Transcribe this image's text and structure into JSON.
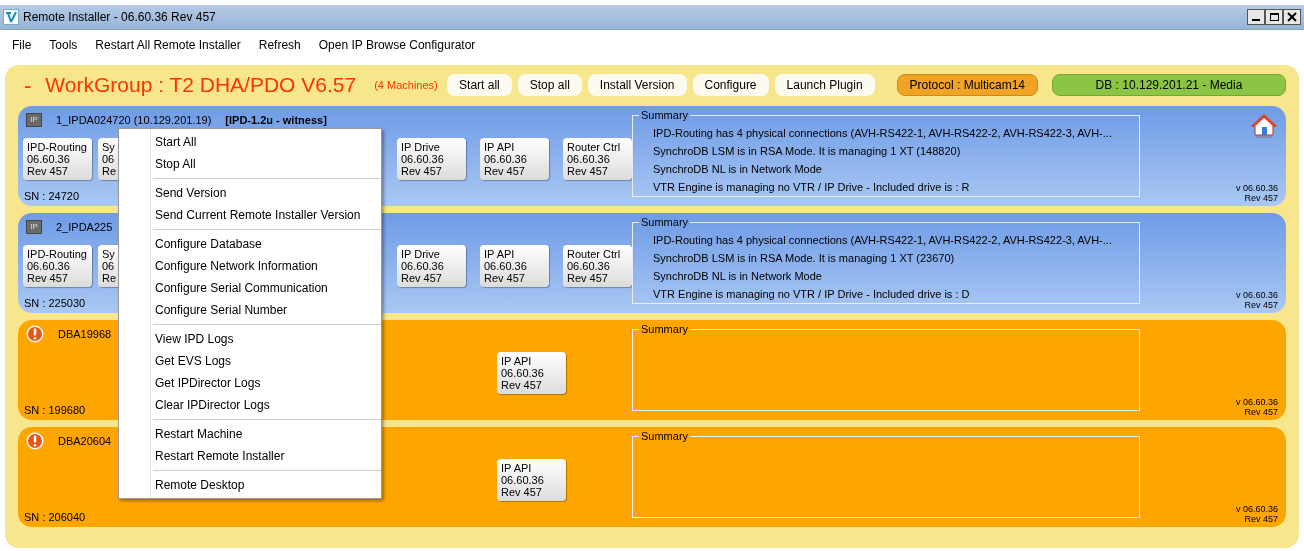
{
  "window": {
    "title": "Remote Installer - 06.60.36 Rev 457"
  },
  "menu_bar": [
    "File",
    "Tools",
    "Restart All Remote Installer",
    "Refresh",
    "Open IP Browse Configurator"
  ],
  "workgroup": {
    "collapse_sign": "-",
    "title": "WorkGroup : T2 DHA/PDO V6.57",
    "count": "(4 Machines)",
    "buttons": [
      {
        "label": "Start all",
        "kind": "plain"
      },
      {
        "label": "Stop all",
        "kind": "plain"
      },
      {
        "label": "Install Version",
        "kind": "plain"
      },
      {
        "label": "Configure",
        "kind": "plain"
      },
      {
        "label": "Launch Plugin",
        "kind": "plain"
      },
      {
        "label": "Protocol : Multicam14",
        "kind": "protocol"
      },
      {
        "label": "DB : 10.129.201.21 - Media",
        "kind": "db"
      }
    ]
  },
  "machines": [
    {
      "kind": "ok",
      "badge": "IP",
      "name": "1_IPDA024720 (10.129.201.19)",
      "tag": "[IPD-1.2u - witness]",
      "home": true,
      "modules_left": [
        {
          "name": "IPD-Routing",
          "version": "06.60.36",
          "rev": "Rev 457"
        },
        {
          "name": "Sy",
          "version": "06",
          "rev": "Re"
        }
      ],
      "modules_right": [
        {
          "name": "IP Drive",
          "version": "06.60.36",
          "rev": "Rev 457"
        },
        {
          "name": "IP API",
          "version": "06.60.36",
          "rev": "Rev 457"
        },
        {
          "name": "Router Ctrl",
          "version": "06.60.36",
          "rev": "Rev 457"
        }
      ],
      "sn": "SN : 24720",
      "summary_title": "Summary",
      "summary": [
        "IPD-Routing has 4 physical connections (AVH-RS422-1, AVH-RS422-2, AVH-RS422-3, AVH-...",
        "SynchroDB LSM is in RSA Mode. It is managing 1 XT (148820)",
        "SynchroDB NL is in Network Mode",
        "VTR Engine is managing no VTR / IP Drive - Included drive is : R"
      ],
      "version": "v 06.60.36",
      "rev": "Rev 457"
    },
    {
      "kind": "ok",
      "badge": "IP",
      "name": "2_IPDA225",
      "home": false,
      "modules_left": [
        {
          "name": "IPD-Routing",
          "version": "06.60.36",
          "rev": "Rev 457"
        },
        {
          "name": "Sy",
          "version": "06",
          "rev": "Re"
        }
      ],
      "modules_right": [
        {
          "name": "IP Drive",
          "version": "06.60.36",
          "rev": "Rev 457"
        },
        {
          "name": "IP API",
          "version": "06.60.36",
          "rev": "Rev 457"
        },
        {
          "name": "Router Ctrl",
          "version": "06.60.36",
          "rev": "Rev 457"
        }
      ],
      "sn": "SN : 225030",
      "summary_title": "Summary",
      "summary": [
        "IPD-Routing has 4 physical connections (AVH-RS422-1, AVH-RS422-2, AVH-RS422-3, AVH-...",
        "SynchroDB LSM is in RSA Mode. It is managing 1 XT (23670)",
        "SynchroDB NL is in Network Mode",
        "VTR Engine is managing no VTR / IP Drive - Included drive is : D"
      ],
      "version": "v 06.60.36",
      "rev": "Rev 457"
    },
    {
      "kind": "warning",
      "name": "DBA19968",
      "home": false,
      "modules_right": [
        {
          "name": "IP API",
          "version": "06.60.36",
          "rev": "Rev 457"
        }
      ],
      "sn": "SN : 199680",
      "summary_title": "Summary",
      "version": "v 06.60.36",
      "rev": "Rev 457"
    },
    {
      "kind": "warning",
      "name": "DBA20604",
      "home": false,
      "modules_right": [
        {
          "name": "IP API",
          "version": "06.60.36",
          "rev": "Rev 457"
        }
      ],
      "sn": "SN : 206040",
      "summary_title": "Summary",
      "version": "v 06.60.36",
      "rev": "Rev 457"
    }
  ],
  "context_menu": {
    "groups": [
      [
        "Start All",
        "Stop All"
      ],
      [
        "Send Version",
        "Send Current Remote Installer Version"
      ],
      [
        "Configure Database",
        "Configure Network Information",
        "Configure Serial Communication",
        "Configure Serial Number"
      ],
      [
        "View IPD Logs",
        "Get EVS Logs",
        "Get IPDirector Logs",
        "Clear IPDirector Logs"
      ],
      [
        "Restart Machine",
        "Restart Remote Installer"
      ],
      [
        "Remote Desktop"
      ]
    ]
  }
}
